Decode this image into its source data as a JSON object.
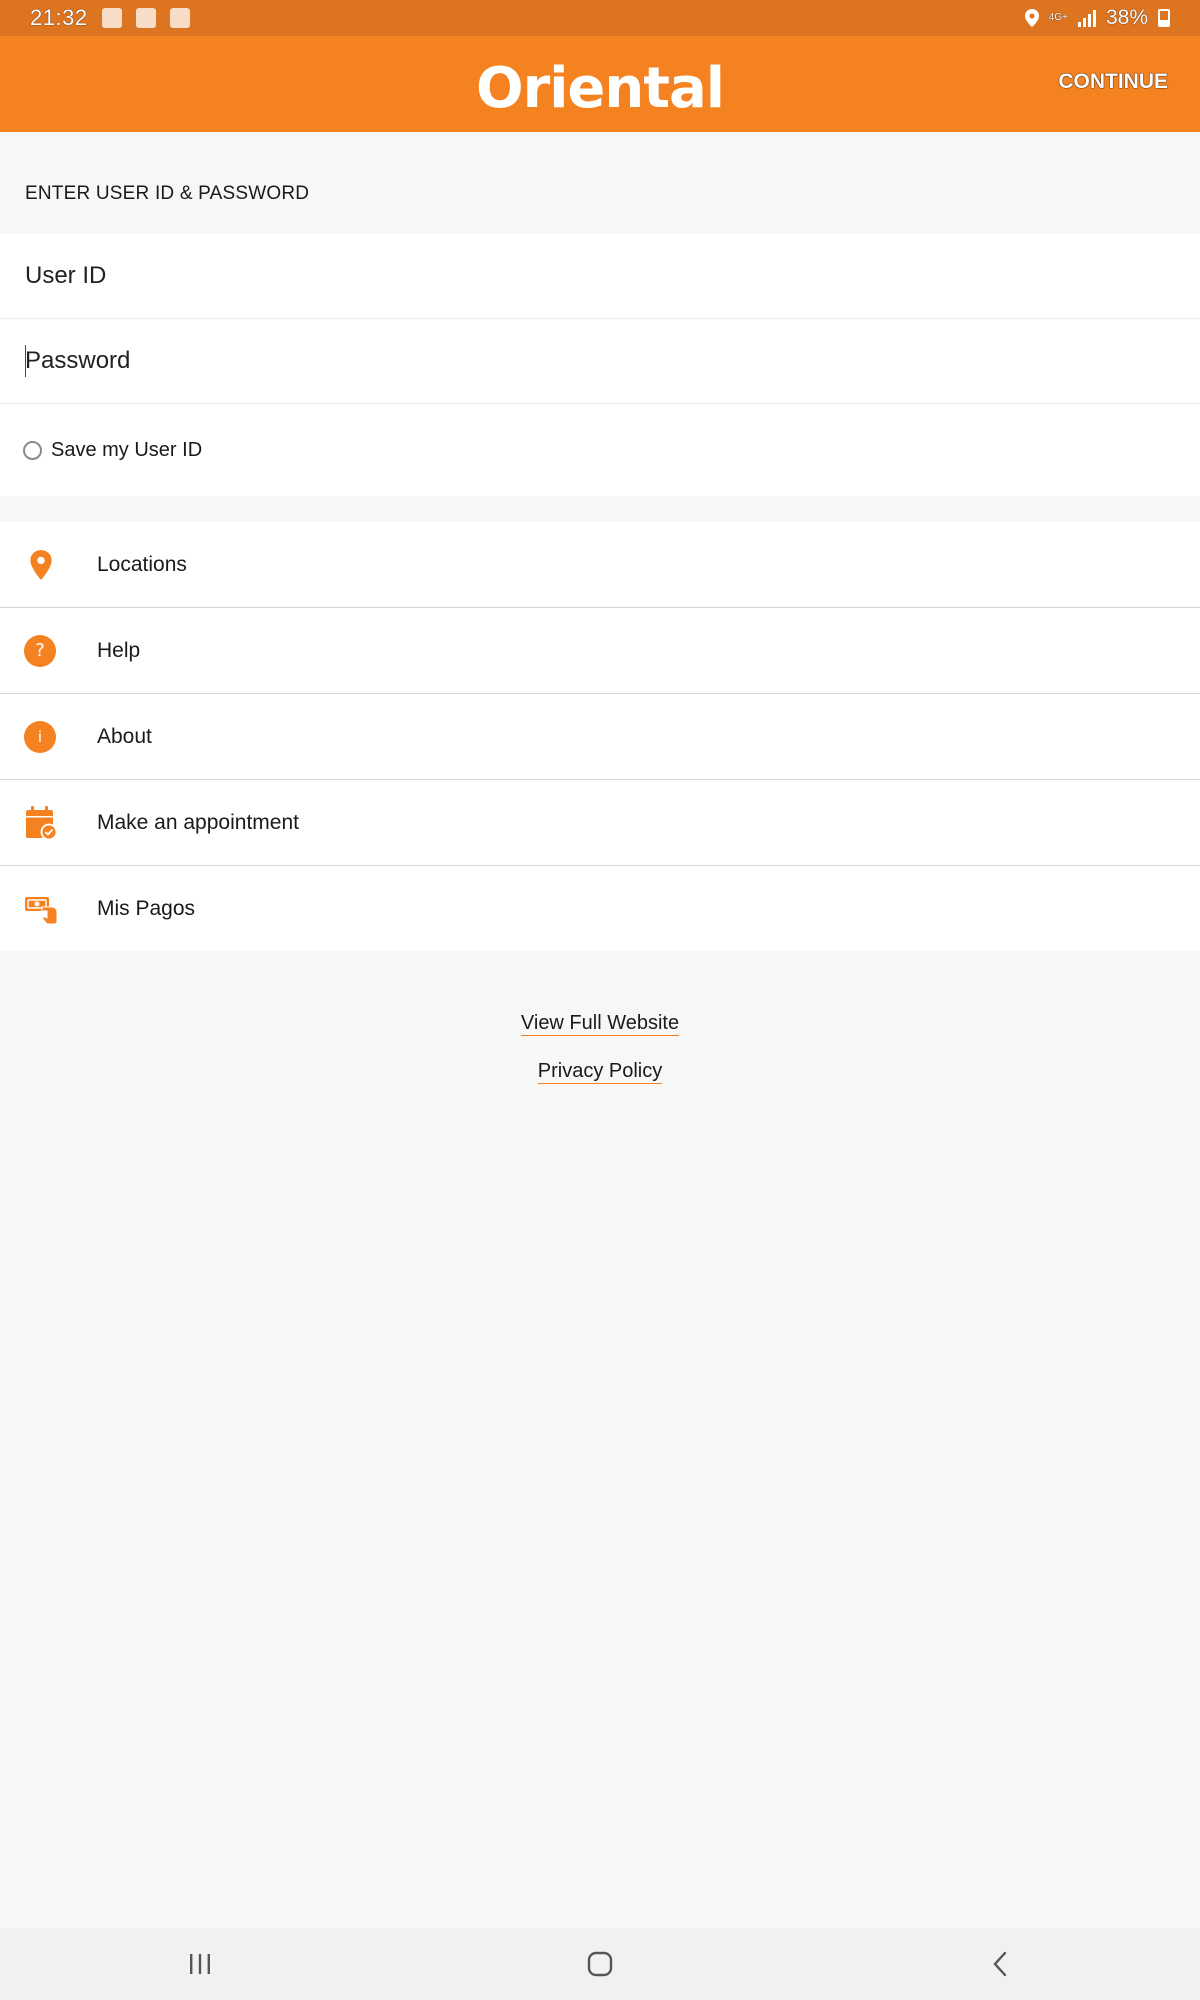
{
  "status_bar": {
    "time": "21:32",
    "battery": "38%",
    "network": "4G+",
    "icons": [
      "gallery-icon",
      "app-notification-icon",
      "wifi-icon",
      "location-icon",
      "signal-icon",
      "battery-icon"
    ]
  },
  "header": {
    "logo_text": "Oriental",
    "continue_label": "CONTINUE"
  },
  "login": {
    "section_title": "ENTER USER ID & PASSWORD",
    "user_id_placeholder": "User ID",
    "password_placeholder": "Password",
    "save_user_id_label": "Save my User ID",
    "save_user_id_checked": false
  },
  "menu": {
    "items": [
      {
        "label": "Locations",
        "icon": "location-pin-icon"
      },
      {
        "label": "Help",
        "icon": "help-icon"
      },
      {
        "label": "About",
        "icon": "info-icon"
      },
      {
        "label": "Make an appointment",
        "icon": "calendar-check-icon"
      },
      {
        "label": "Mis Pagos",
        "icon": "payment-hand-icon"
      }
    ]
  },
  "footer": {
    "full_website_label": "View Full Website",
    "privacy_label": "Privacy Policy"
  },
  "nav_bar": {
    "buttons": [
      "recent-apps-icon",
      "home-icon",
      "back-icon"
    ]
  },
  "colors": {
    "brand_orange": "#f58220",
    "status_bar": "#dd7420",
    "background": "#f7f7f7"
  }
}
